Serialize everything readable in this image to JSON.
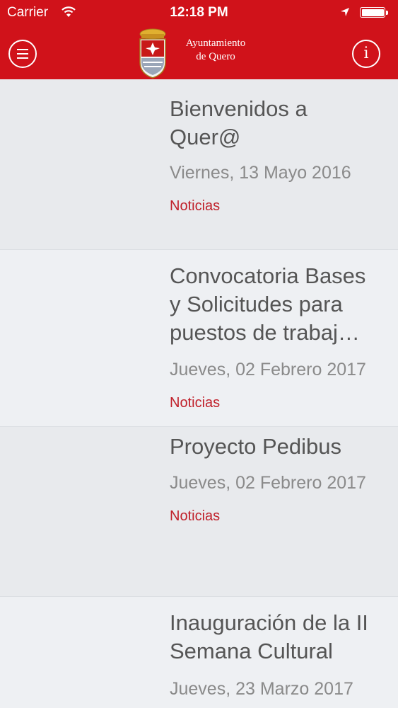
{
  "status": {
    "carrier": "Carrier",
    "time": "12:18 PM"
  },
  "header": {
    "brand_line1": "Ayuntamiento",
    "brand_line2": "de Quero",
    "menu_icon": "hamburger-menu-icon",
    "info_icon": "info-icon",
    "info_glyph": "i",
    "accent": "#d0121a"
  },
  "news": [
    {
      "title_lines": [
        "Bienvenidos a",
        "Quer@"
      ],
      "date": "Viernes, 13 Mayo 2016",
      "category": "Noticias"
    },
    {
      "title_lines": [
        "Convocatoria Bases",
        "y Solicitudes para",
        "puestos de trabaj…"
      ],
      "date": "Jueves, 02 Febrero 2017",
      "category": "Noticias"
    },
    {
      "title_lines": [
        "Proyecto Pedibus"
      ],
      "date": "Jueves, 02 Febrero 2017",
      "category": "Noticias"
    },
    {
      "title_lines": [
        "Inauguración de la II",
        "Semana Cultural"
      ],
      "date": "Jueves, 23 Marzo 2017",
      "category": ""
    }
  ]
}
